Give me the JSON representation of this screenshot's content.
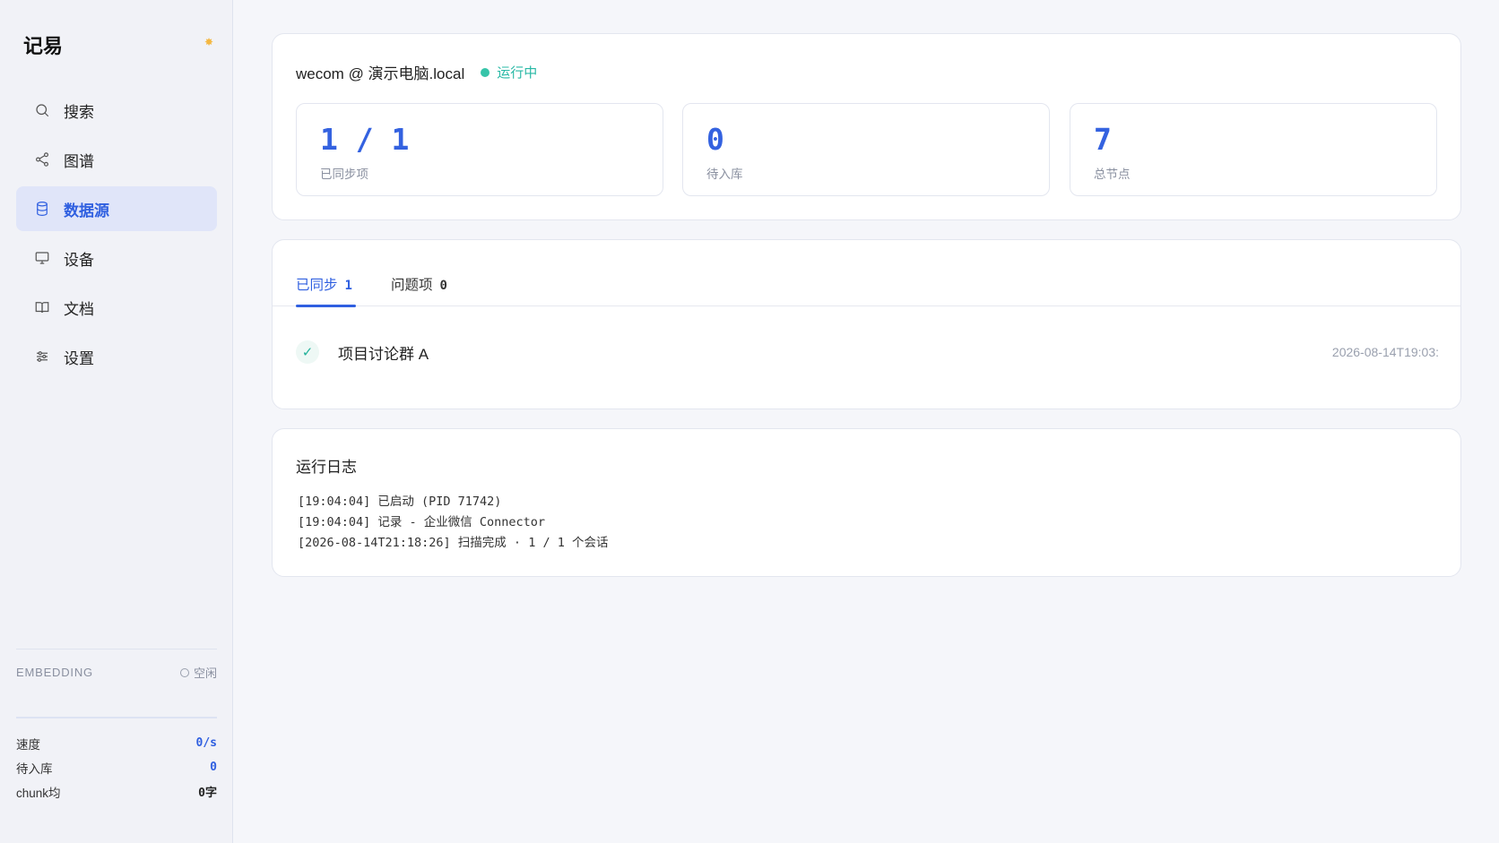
{
  "app": {
    "brand": "记易"
  },
  "sidebar": {
    "items": [
      {
        "label": "搜索",
        "icon": "search-icon"
      },
      {
        "label": "图谱",
        "icon": "share-graph-icon"
      },
      {
        "label": "数据源",
        "icon": "database-icon",
        "active": true
      },
      {
        "label": "设备",
        "icon": "monitor-icon"
      },
      {
        "label": "文档",
        "icon": "book-icon"
      },
      {
        "label": "设置",
        "icon": "sliders-icon"
      }
    ],
    "embedding": {
      "label": "EMBEDDING",
      "status": "空闲"
    },
    "stats": [
      {
        "label": "速度",
        "value": "0/s"
      },
      {
        "label": "待入库",
        "value": "0"
      },
      {
        "label": "chunk均",
        "value": "0字"
      }
    ]
  },
  "source": {
    "title": "wecom @ 演示电脑.local",
    "status": "运行中",
    "metrics": [
      {
        "value": "1 / 1",
        "label": "已同步项"
      },
      {
        "value": "0",
        "label": "待入库"
      },
      {
        "value": "7",
        "label": "总节点"
      }
    ]
  },
  "tabs": [
    {
      "label": "已同步",
      "count": "1",
      "active": true
    },
    {
      "label": "问题项",
      "count": "0"
    }
  ],
  "synced_items": [
    {
      "name": "项目讨论群 A",
      "time": "2026-08-14T19:03:"
    }
  ],
  "log": {
    "title": "运行日志",
    "lines": [
      "[19:04:04] 已启动 (PID 71742)",
      "[19:04:04] 记录 - 企业微信 Connector",
      "[2026-08-14T21:18:26] 扫描完成 · 1 / 1 个会话"
    ]
  },
  "colors": {
    "accent": "#2f5fe0",
    "running": "#27b8a5"
  }
}
